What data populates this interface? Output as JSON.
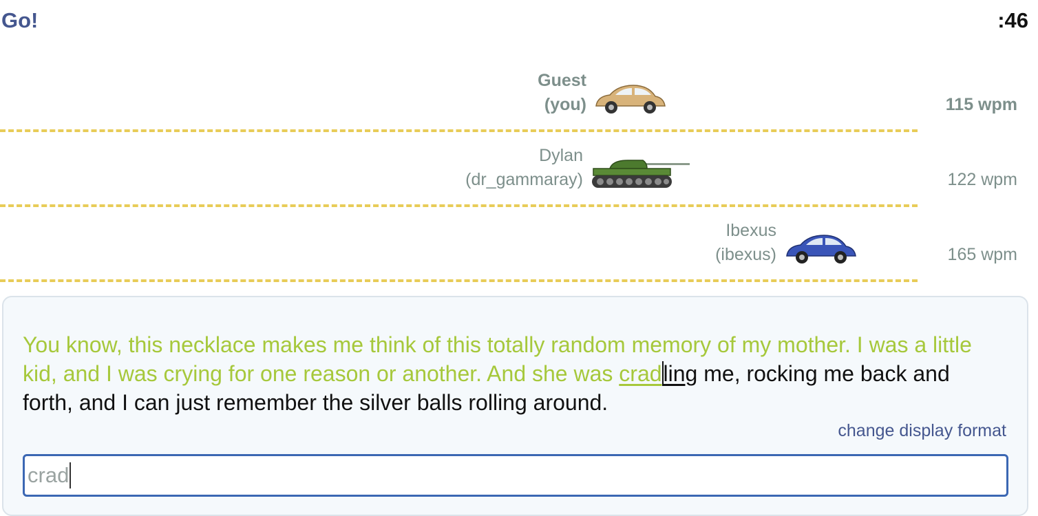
{
  "header": {
    "status": "Go!",
    "timer": ":46"
  },
  "racers": [
    {
      "name": "Guest",
      "handle": "(you)",
      "wpm": "115 wpm",
      "vehicle": "beige-car-icon",
      "color": "#d8b37a",
      "is_self": true
    },
    {
      "name": "Dylan",
      "handle": "(dr_gammaray)",
      "wpm": "122 wpm",
      "vehicle": "green-tank-icon",
      "color": "#4c7a2e",
      "is_self": false
    },
    {
      "name": "Ibexus",
      "handle": "(ibexus)",
      "wpm": "165 wpm",
      "vehicle": "blue-car-icon",
      "color": "#3a55b8",
      "is_self": false
    }
  ],
  "passage": {
    "typed": "You know, this necklace makes me think of this totally random memory of my mother. I was a little kid, and I was crying for one reason or another. And she was ",
    "current_typed": "crad",
    "current_rest": "ling",
    "remaining": " me, rocking me back and forth, and I can just remember the silver balls rolling around."
  },
  "change_format_label": "change display format",
  "input": {
    "value": "crad"
  },
  "colors": {
    "accent": "#45578f",
    "typed_text": "#a6c83b",
    "lane_line": "#e8cc58",
    "input_border": "#3b67b3"
  }
}
